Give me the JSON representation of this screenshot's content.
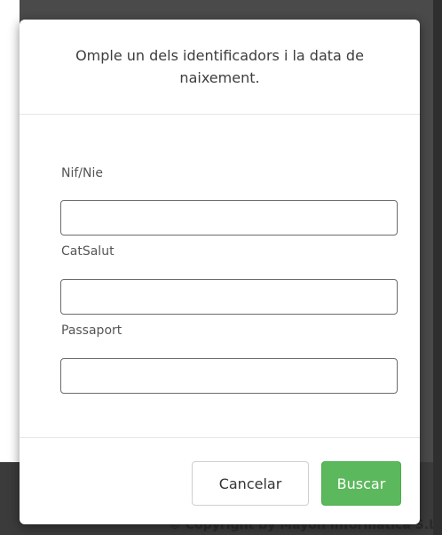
{
  "footer": {
    "copyright": "© Copyright by Mayon Informàtica S.L"
  },
  "dialog": {
    "title": "Omple un dels identificadors i la data de naixement.",
    "fields": [
      {
        "label": "Nif/Nie",
        "value": ""
      },
      {
        "label": "CatSalut",
        "value": ""
      },
      {
        "label": "Passaport",
        "value": ""
      }
    ],
    "buttons": {
      "cancel": "Cancelar",
      "search": "Buscar"
    }
  },
  "colors": {
    "primary_button": "#5cb85c",
    "overlay": "#4a4a4a"
  }
}
